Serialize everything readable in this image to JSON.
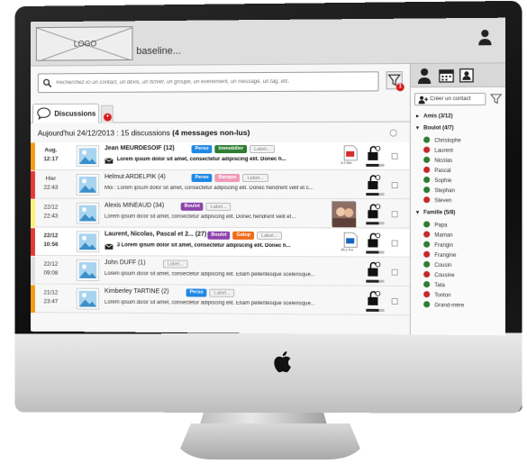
{
  "header": {
    "logo_text": "LOGO",
    "baseline": "baseline..."
  },
  "search": {
    "placeholder": "Recherchez ici un contact, un devis, un fichier, un groupe, un évènement, un message, un tag, etc.",
    "filter_badge": "1"
  },
  "tabs": {
    "discussions_label": "Discussions",
    "add_badge": "+"
  },
  "summary": {
    "prefix": "Aujourd'hui 24/12/2013 : 15 discussions ",
    "unread": "(4 messages non-lus)"
  },
  "rows": [
    {
      "date": "Aug.",
      "time": "12:17",
      "bold": true,
      "bar": "#f39c12",
      "name": "Jean MEURDESOIF (12)",
      "tags": [
        {
          "t": "Perso",
          "c": "perso"
        },
        {
          "t": "Immobilier",
          "c": "immo"
        },
        {
          "t": "Label...",
          "c": "label"
        }
      ],
      "preview": "Lorem ipsum dolor sit amet, consectetur adipiscing elit. Donec h...",
      "mail": true,
      "attach": "pdf",
      "attach_size": "3,2 Mo"
    },
    {
      "date": "Hier",
      "time": "22:43",
      "bold": false,
      "bar": "#e53935",
      "name": "Helmut ARDELPIK (4)",
      "tags": [
        {
          "t": "Perso",
          "c": "perso"
        },
        {
          "t": "Banque",
          "c": "banque"
        },
        {
          "t": "Label...",
          "c": "label"
        }
      ],
      "preview": "Moi : Lorem ipsum dolor sit amet, consectetur adipiscing elit. Donec hendrerit velit et c...",
      "mail": false,
      "attach": "",
      "attach_size": ""
    },
    {
      "date": "22/12",
      "time": "22:43",
      "bold": false,
      "bar": "#fff176",
      "name": "Alexis MINEAUD (34)",
      "tags": [
        {
          "t": "Boulot",
          "c": "boulot"
        },
        {
          "t": "Label...",
          "c": "label"
        }
      ],
      "preview": "Lorem ipsum dolor sit amet, consectetur adipiscing elit. Donec hendrerit velit et...",
      "mail": false,
      "attach": "photo",
      "attach_size": ""
    },
    {
      "date": "22/12",
      "time": "10:56",
      "bold": true,
      "bar": "#e53935",
      "name": "Laurent, Nicolas, Pascal et 2... (27)",
      "tags": [
        {
          "t": "Boulot",
          "c": "boulot"
        },
        {
          "t": "Galop",
          "c": "gallop"
        },
        {
          "t": "Label...",
          "c": "label"
        }
      ],
      "preview": "3 Lorem ipsum dolor sit amet, consectetur adipiscing elit. Donec h...",
      "mail": true,
      "attach": "doc",
      "attach_size": "15,1 Ko"
    },
    {
      "date": "22/12",
      "time": "09:08",
      "bold": false,
      "bar": "#e0e0e0",
      "name": "John DUFF (1)",
      "tags": [
        {
          "t": "Label...",
          "c": "label"
        }
      ],
      "preview": "Lorem ipsum dolor sit amet, consectetur adipiscing elit. Etiam pellentesque scelerisque...",
      "mail": false,
      "attach": "",
      "attach_size": ""
    },
    {
      "date": "21/12",
      "time": "23:47",
      "bold": false,
      "bar": "#f39c12",
      "name": "Kimberley TARTINE (2)",
      "tags": [
        {
          "t": "Perso",
          "c": "perso"
        },
        {
          "t": "Label...",
          "c": "label"
        }
      ],
      "preview": "Lorem ipsum dolor sit amet, consectetur adipiscing elit. Etiam pellentesque scelerisque...",
      "mail": false,
      "attach": "",
      "attach_size": ""
    }
  ],
  "right_panel": {
    "create_label": "Créer un contact",
    "groups": [
      {
        "label": "Amis (3/12)",
        "open": false
      },
      {
        "label": "Boulot (4/7)",
        "open": true,
        "contacts": [
          {
            "name": "Christophe",
            "s": "g"
          },
          {
            "name": "Laurent",
            "s": "r"
          },
          {
            "name": "Nicolas",
            "s": "g"
          },
          {
            "name": "Pascal",
            "s": "r"
          },
          {
            "name": "Sophie",
            "s": "g"
          },
          {
            "name": "Stephan",
            "s": "g"
          },
          {
            "name": "Steven",
            "s": "r"
          }
        ]
      },
      {
        "label": "Famille (5/8)",
        "open": true,
        "contacts": [
          {
            "name": "Papa",
            "s": "g"
          },
          {
            "name": "Maman",
            "s": "r"
          },
          {
            "name": "Frangin",
            "s": "g"
          },
          {
            "name": "Frangine",
            "s": "r"
          },
          {
            "name": "Cousin",
            "s": "g"
          },
          {
            "name": "Cousine",
            "s": "r"
          },
          {
            "name": "Tata",
            "s": "g"
          },
          {
            "name": "Tonton",
            "s": "r"
          },
          {
            "name": "Grand-mère",
            "s": "g"
          }
        ]
      }
    ]
  },
  "colors": {
    "online": "#2e7d32",
    "offline": "#c62828"
  }
}
